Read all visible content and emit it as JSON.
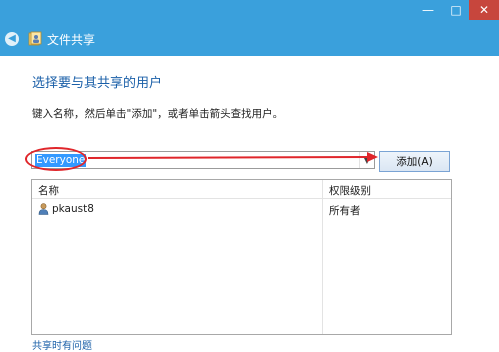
{
  "window": {
    "title": "文件共享",
    "controls": {
      "minimize": "—",
      "maximize": "□",
      "close": "✕"
    },
    "accent": "#3aa0dc"
  },
  "main": {
    "heading": "选择要与其共享的用户",
    "instruction": "键入名称，然后单击\"添加\"，或者单击箭头查找用户。",
    "input_value": "Everyone",
    "add_button": "添加(A)",
    "annotation_color": "#e0262b"
  },
  "list": {
    "columns": {
      "name": "名称",
      "permission": "权限级别"
    },
    "rows": [
      {
        "name": "pkaust8",
        "permission": "所有者"
      }
    ]
  },
  "footer": {
    "help_link": "共享时有问题"
  }
}
